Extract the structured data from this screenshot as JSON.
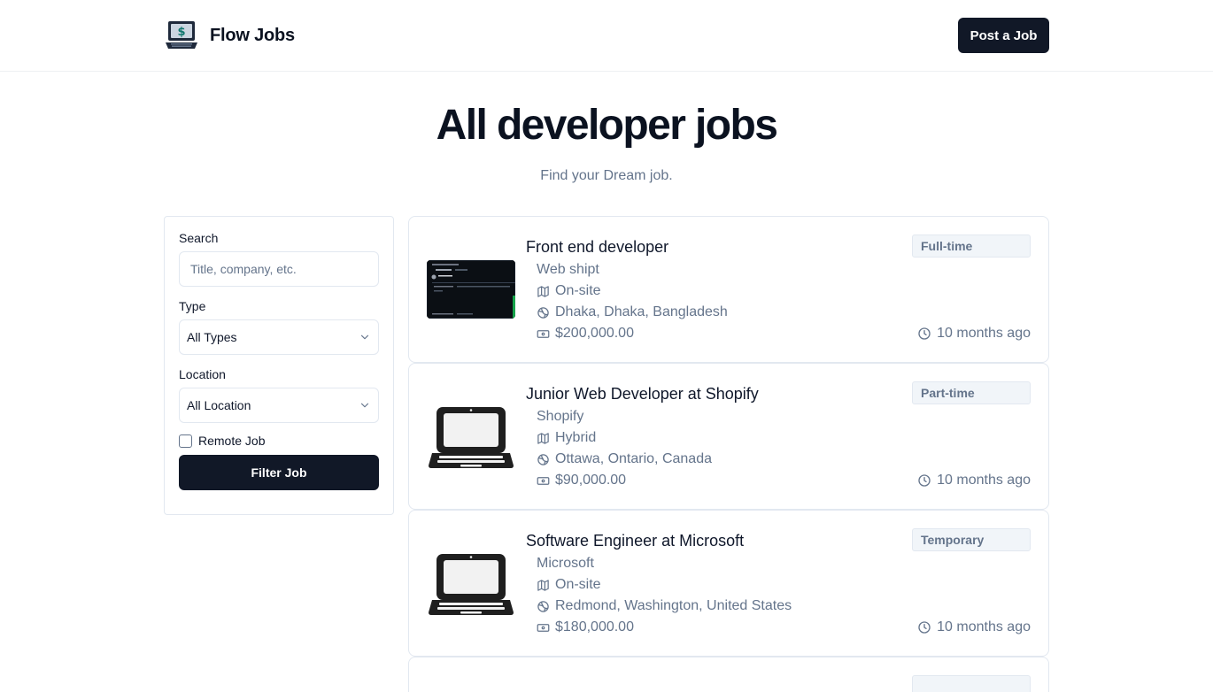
{
  "header": {
    "brand": "Flow Jobs",
    "post_button": "Post a Job"
  },
  "hero": {
    "title": "All developer jobs",
    "subtitle": "Find your Dream job."
  },
  "filters": {
    "search_label": "Search",
    "search_placeholder": "Title, company, etc.",
    "search_value": "",
    "type_label": "Type",
    "type_value": "All Types",
    "location_label": "Location",
    "location_value": "All Location",
    "remote_label": "Remote Job",
    "remote_checked": false,
    "filter_button": "Filter Job"
  },
  "jobs": [
    {
      "title": "Front end developer",
      "company": "Web shipt",
      "location_type": "On-site",
      "location": "Dhaka, Dhaka, Bangladesh",
      "salary": "$200,000.00",
      "type": "Full-time",
      "posted": "10 months ago",
      "logo": "screenshot-thumbnail"
    },
    {
      "title": "Junior Web Developer at Shopify",
      "company": "Shopify",
      "location_type": "Hybrid",
      "location": "Ottawa, Ontario, Canada",
      "salary": "$90,000.00",
      "type": "Part-time",
      "posted": "10 months ago",
      "logo": "laptop-icon"
    },
    {
      "title": "Software Engineer at Microsoft",
      "company": "Microsoft",
      "location_type": "On-site",
      "location": "Redmond, Washington, United States",
      "salary": "$180,000.00",
      "type": "Temporary",
      "posted": "10 months ago",
      "logo": "laptop-icon"
    }
  ],
  "icons": {
    "location_type": "map-icon",
    "location": "globe-icon",
    "salary": "banknote-icon",
    "posted": "clock-icon",
    "select": "chevron-down-icon"
  },
  "colors": {
    "primary": "#111827",
    "muted_text": "#64748b",
    "border": "#e2e8f0",
    "badge_bg": "#f1f5f9"
  }
}
